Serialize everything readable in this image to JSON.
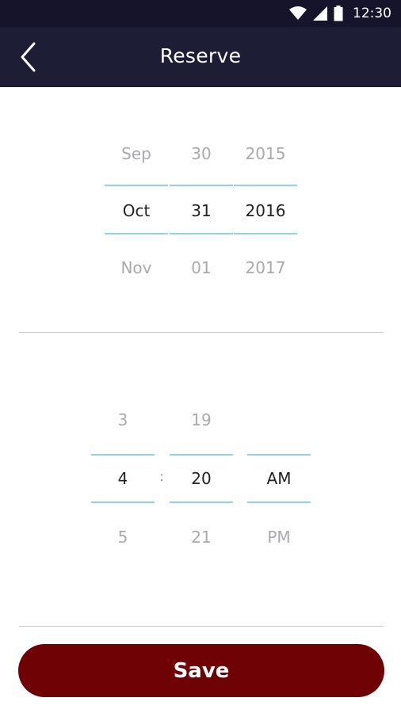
{
  "status_bar": {
    "time": "12:30",
    "icons": [
      "wifi-icon",
      "cell-signal-icon",
      "battery-icon"
    ]
  },
  "app_bar": {
    "title": "Reserve",
    "back_icon": "chevron-left-icon"
  },
  "date_picker": {
    "month": {
      "prev": "Sep",
      "selected": "Oct",
      "next": "Nov"
    },
    "day": {
      "prev": "30",
      "selected": "31",
      "next": "01"
    },
    "year": {
      "prev": "2015",
      "selected": "2016",
      "next": "2017"
    }
  },
  "time_picker": {
    "hour": {
      "prev": "3",
      "selected": "4",
      "next": "5"
    },
    "separator": ":",
    "minute": {
      "prev": "19",
      "selected": "20",
      "next": "21"
    },
    "period": {
      "prev": "",
      "selected": "AM",
      "next": "PM"
    }
  },
  "actions": {
    "save_label": "Save"
  },
  "colors": {
    "status_bar_bg": "#15142a",
    "app_bar_bg": "#1e1d36",
    "selection_line": "#8fd3ea",
    "save_button_bg": "#6e0204"
  }
}
